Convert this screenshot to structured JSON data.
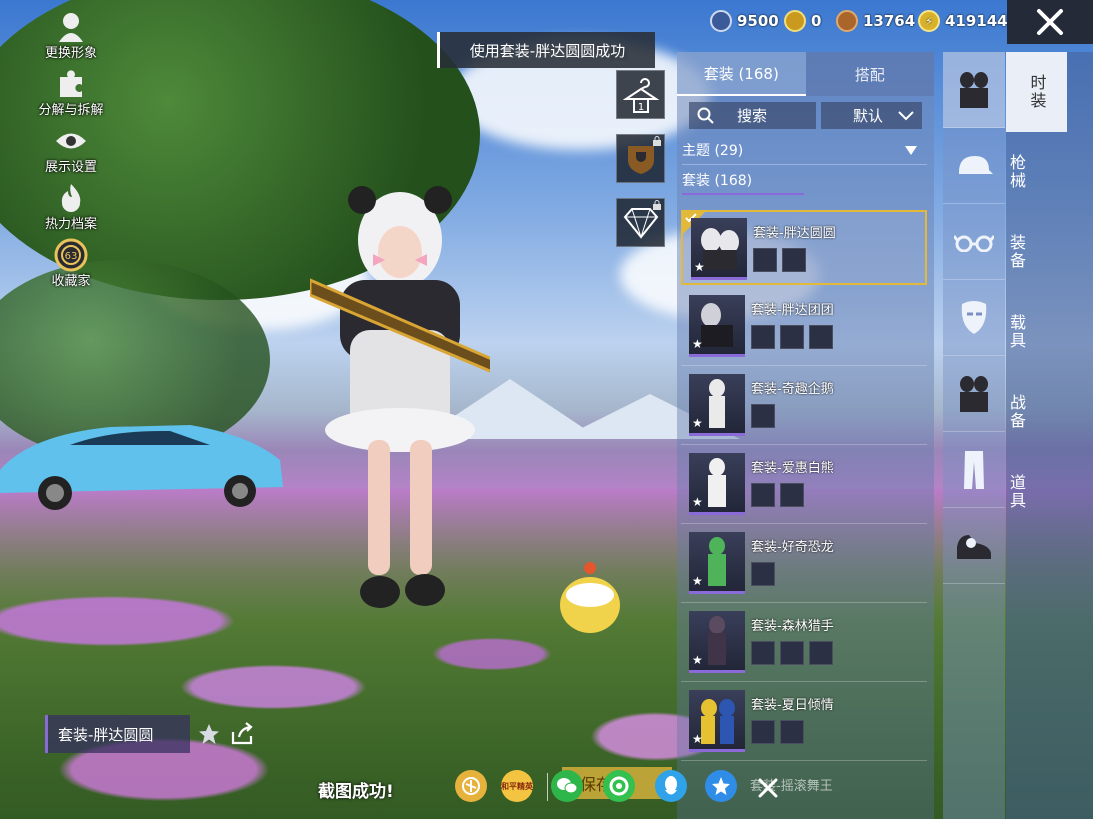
{
  "left_menu": [
    {
      "label": "更换形象",
      "icon": "avatar-icon"
    },
    {
      "label": "分解与拆解",
      "icon": "puzzle-icon"
    },
    {
      "label": "展示设置",
      "icon": "eye-icon"
    },
    {
      "label": "热力档案",
      "icon": "flame-icon"
    },
    {
      "label": "收藏家",
      "icon": "collector-badge-icon",
      "badge": "63"
    }
  ],
  "toast": "使用套装-胖达圆圆成功",
  "fashion_label": "时装",
  "currencies": [
    {
      "icon": "silver-coin-icon",
      "value": "9500",
      "color": "#3a5a9a"
    },
    {
      "icon": "gold-coupon-icon",
      "value": "0",
      "color": "#c99a1e"
    },
    {
      "icon": "bronze-coin-icon",
      "value": "13764",
      "color": "#a9652a"
    },
    {
      "icon": "energy-coin-icon",
      "value": "419144",
      "color": "#d8b22a"
    }
  ],
  "mid_buttons": [
    {
      "icon": "hanger-icon",
      "locked": false
    },
    {
      "icon": "trophy-shield-icon",
      "locked": true
    },
    {
      "icon": "diamond-icon",
      "locked": true
    }
  ],
  "tabs": [
    {
      "label": "套装 (168)",
      "active": true
    },
    {
      "label": "搭配",
      "active": false
    }
  ],
  "search": {
    "placeholder": "搜索"
  },
  "sort": {
    "label": "默认"
  },
  "filters": {
    "theme": "主题 (29)",
    "outfit": "套装 (168)"
  },
  "items": [
    {
      "name": "套装-胖达圆圆",
      "pieces": 2,
      "selected": true,
      "color": "#e8e8ec"
    },
    {
      "name": "套装-胖达团团",
      "pieces": 3,
      "selected": false,
      "color": "#d0d0d8"
    },
    {
      "name": "套装-奇趣企鹅",
      "pieces": 1,
      "selected": false,
      "color": "#eaeaea"
    },
    {
      "name": "套装-爱惠白熊",
      "pieces": 2,
      "selected": false,
      "color": "#f0f0f0"
    },
    {
      "name": "套装-好奇恐龙",
      "pieces": 1,
      "selected": false,
      "color": "#4fb35a"
    },
    {
      "name": "套装-森林猎手",
      "pieces": 3,
      "selected": false,
      "color": "#5b4a60"
    },
    {
      "name": "套装-夏日倾情",
      "pieces": 2,
      "selected": false,
      "color": "#e6c233"
    }
  ],
  "bottom_item_name": "套装-摇滚舞王",
  "categories_icons": [
    "outfit-icon",
    "cap-icon",
    "glasses-icon",
    "mask-icon",
    "outfit-set-icon",
    "pants-icon",
    "shoes-icon"
  ],
  "categories_text": [
    {
      "label": "时装",
      "active": true
    },
    {
      "label": "枪械",
      "active": false
    },
    {
      "label": "装备",
      "active": false
    },
    {
      "label": "载具",
      "active": false
    },
    {
      "label": "战备",
      "active": false
    },
    {
      "label": "道具",
      "active": false
    }
  ],
  "outfit_name": "套装-胖达圆圆",
  "share_bar": {
    "success_text": "截图成功!",
    "save_label": "保存",
    "peace_label": "和平精英",
    "icons": [
      "peace-logo-icon",
      "peace-elite-icon",
      "wechat-icon",
      "moments-icon",
      "qq-icon",
      "qzone-icon"
    ]
  }
}
